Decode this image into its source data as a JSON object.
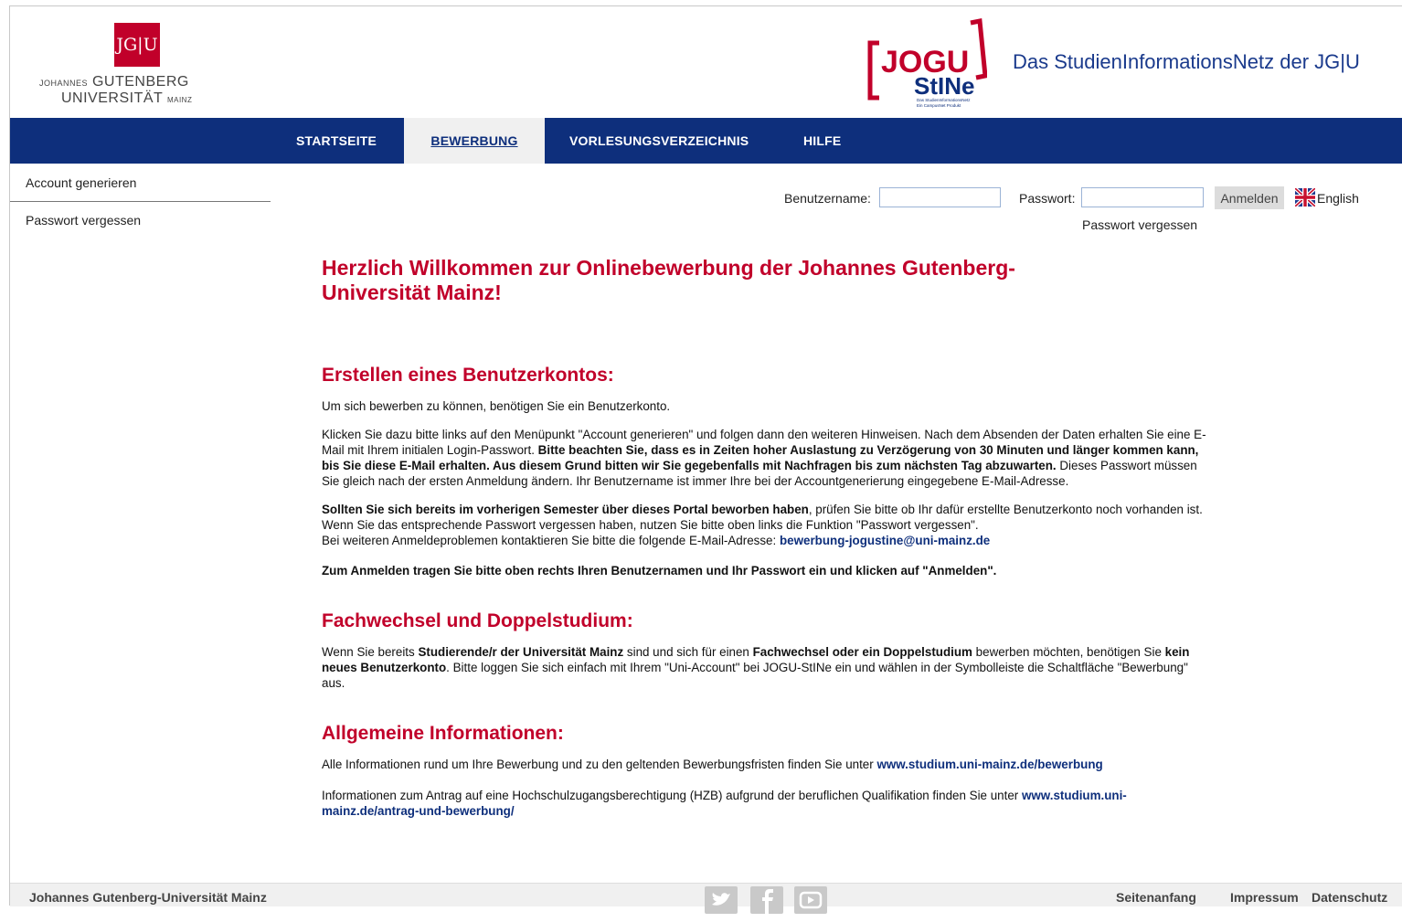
{
  "header": {
    "jgu_logo_box": "JG|U",
    "jgu_name_small1": "JOHANNES",
    "jgu_name_big1": "GUTENBERG",
    "jgu_name_big2": "UNIVERSITÄT",
    "jgu_name_small2": "MAINZ",
    "stine_logo_top": "JOGU",
    "stine_logo_bottom": "StINe",
    "stine_logo_sub1": "Das StudienInformationsNetz",
    "stine_logo_sub2": "Ein CampusNet Produkt",
    "tagline": "Das StudienInformationsNetz der JG|U"
  },
  "nav": {
    "items": [
      {
        "label": "STARTSEITE"
      },
      {
        "label": "BEWERBUNG"
      },
      {
        "label": "VORLESUNGSVERZEICHNIS"
      },
      {
        "label": "HILFE"
      }
    ]
  },
  "sidebar": {
    "items": [
      {
        "label": "Account generieren"
      },
      {
        "label": "Passwort vergessen"
      }
    ]
  },
  "login": {
    "username_label": "Benutzername:",
    "username_value": "",
    "password_label": "Passwort:",
    "password_value": "",
    "submit_label": "Anmelden",
    "language_label": "English",
    "forgot_label": "Passwort vergessen"
  },
  "main": {
    "welcome": "Herzlich Willkommen zur Onlinebewerbung der Johannes Gutenberg-Universität Mainz!",
    "section1": {
      "title": "Erstellen eines Benutzerkontos:",
      "p1": "Um sich bewerben zu können, benötigen Sie ein Benutzerkonto.",
      "p2a": "Klicken Sie dazu bitte links auf den Menüpunkt \"Account generieren\" und folgen dann den weiteren Hinweisen. Nach dem Absenden der Daten erhalten Sie eine E-Mail mit Ihrem initialen Login-Passwort.",
      "p2b": "Bitte beachten Sie, dass es in Zeiten hoher Auslastung zu Verzögerung von 30 Minuten und länger kommen kann, bis Sie diese E-Mail erhalten. Aus diesem Grund bitten wir Sie gegebenfalls mit Nachfragen bis zum nächsten Tag abzuwarten.",
      "p2c": "Dieses Passwort müssen Sie gleich nach der ersten Anmeldung ändern. Ihr Benutzername ist immer Ihre bei der Accountgenerierung eingegebene E-Mail-Adresse.",
      "p3a": "Sollten Sie sich bereits im vorherigen Semester über dieses Portal beworben haben",
      "p3b": ", prüfen Sie bitte ob Ihr dafür erstellte Benutzerkonto noch vorhanden ist.",
      "p3c": "Wenn Sie das entsprechende Passwort vergessen haben, nutzen Sie bitte oben links die Funktion \"Passwort vergessen\".",
      "p3d": "Bei weiteren Anmeldeproblemen kontaktieren Sie bitte die folgende E-Mail-Adresse: ",
      "p3_mail": "bewerbung-jogustine@uni-mainz.de",
      "p4": "Zum Anmelden tragen Sie bitte oben rechts Ihren Benutzernamen und Ihr Passwort ein und klicken auf \"Anmelden\"."
    },
    "section2": {
      "title": "Fachwechsel und Doppelstudium:",
      "t1": "Wenn Sie bereits ",
      "b1": "Studierende/r der Universität Mainz",
      "t2": " sind und sich für einen ",
      "b2": "Fachwechsel oder ein Doppelstudium",
      "t3": " bewerben möchten, benötigen Sie ",
      "b3": "kein neues Benutzerkonto",
      "t4": ". Bitte loggen Sie sich einfach mit Ihrem \"Uni-Account\" bei JOGU-StINe ein und wählen in der Symbolleiste die Schaltfläche \"Bewerbung\" aus."
    },
    "section3": {
      "title": "Allgemeine Informationen:",
      "p1": "Alle Informationen rund um Ihre Bewerbung und zu den geltenden Bewerbungsfristen finden Sie unter ",
      "link1": "www.studium.uni-mainz.de/bewerbung",
      "p2": "Informationen zum Antrag auf eine Hochschulzugangsberechtigung (HZB) aufgrund der beruflichen Qualifikation finden Sie unter ",
      "link2": "www.studium.uni-mainz.de/antrag-und-bewerbung/"
    }
  },
  "footer": {
    "left": "Johannes Gutenberg-Universität Mainz",
    "top_link": "Seitenanfang",
    "impressum": "Impressum",
    "datenschutz": "Datenschutz",
    "social_icons": [
      "twitter-icon",
      "facebook-icon",
      "youtube-icon"
    ]
  },
  "colors": {
    "brand_red": "#c1002a",
    "nav_blue": "#0e2f7c"
  }
}
